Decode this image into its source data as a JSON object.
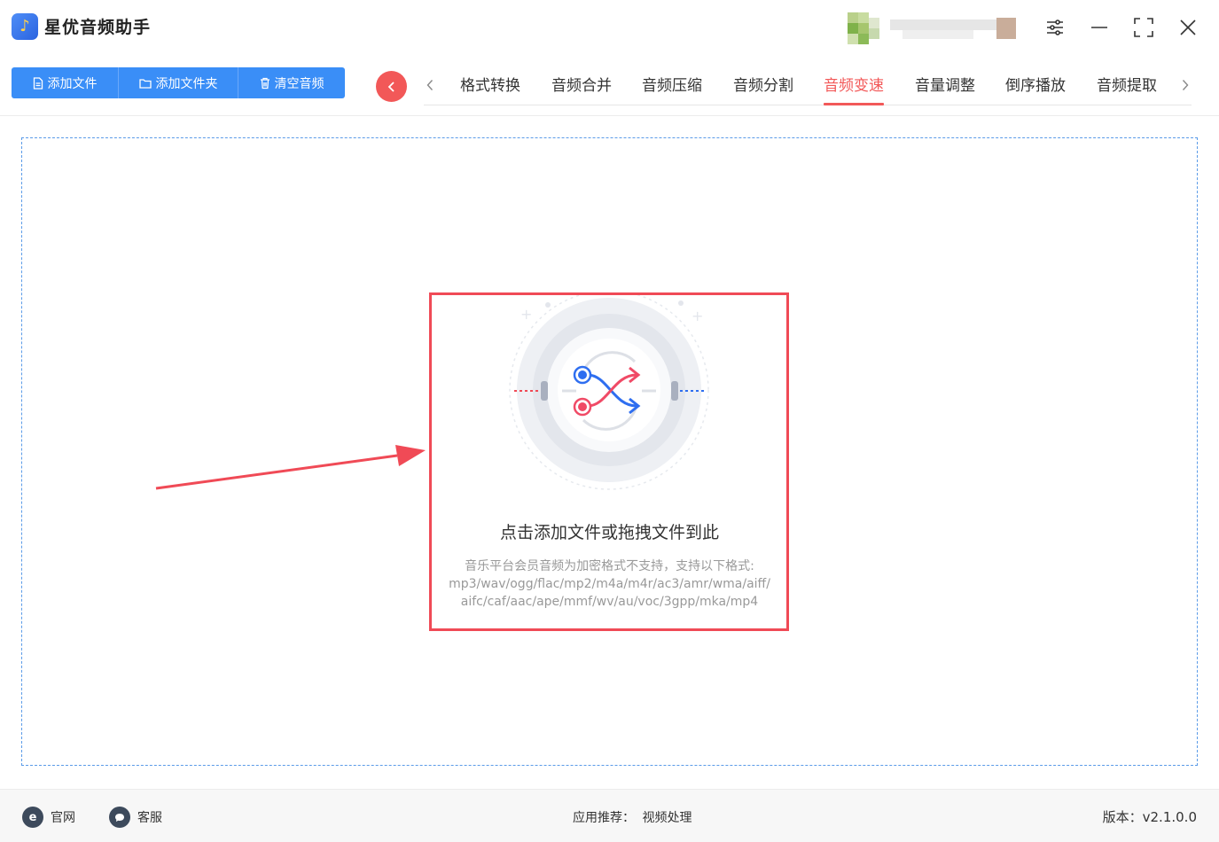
{
  "app": {
    "title": "星优音频助手",
    "logo_icon": "music-note-icon",
    "accent": "#3a8ef7",
    "highlight": "#f25858"
  },
  "window_controls": [
    {
      "name": "settings-sliders-icon"
    },
    {
      "name": "minimize-icon"
    },
    {
      "name": "maximize-icon"
    },
    {
      "name": "close-icon"
    }
  ],
  "toolbar": {
    "add_file": "添加文件",
    "add_folder": "添加文件夹",
    "clear_audio": "清空音频"
  },
  "tabs": [
    {
      "label": "格式转换",
      "active": false
    },
    {
      "label": "音频合并",
      "active": false
    },
    {
      "label": "音频压缩",
      "active": false
    },
    {
      "label": "音频分割",
      "active": false
    },
    {
      "label": "音频变速",
      "active": true
    },
    {
      "label": "音量调整",
      "active": false
    },
    {
      "label": "倒序播放",
      "active": false
    },
    {
      "label": "音频提取",
      "active": false
    }
  ],
  "dropzone": {
    "main_text": "点击添加文件或拖拽文件到此",
    "sub_lines": [
      "音乐平台会员音频为加密格式不支持，支持以下格式:",
      "mp3/wav/ogg/flac/mp2/m4a/m4r/ac3/amr/wma/aiff/",
      "aifc/caf/aac/ape/mmf/wv/au/voc/3gpp/mka/mp4"
    ]
  },
  "footer": {
    "website": "官网",
    "support": "客服",
    "recommend_label": "应用推荐：",
    "recommend_value": "视频处理",
    "version": "版本：v2.1.0.0"
  }
}
